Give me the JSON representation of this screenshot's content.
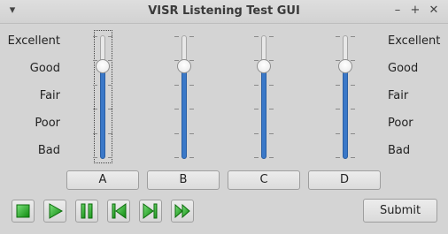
{
  "window": {
    "title": "VISR Listening Test GUI",
    "menu_icon": "chevron-down-icon",
    "minimize_icon": "minimize-icon",
    "maximize_icon": "plus-icon",
    "close_icon": "close-icon"
  },
  "scale_labels": [
    "Excellent",
    "Good",
    "Fair",
    "Poor",
    "Bad"
  ],
  "sliders": [
    {
      "name": "A",
      "value": 0.78
    },
    {
      "name": "B",
      "value": 0.78
    },
    {
      "name": "C",
      "value": 0.78
    },
    {
      "name": "D",
      "value": 0.78
    }
  ],
  "stimulus_buttons": [
    "A",
    "B",
    "C",
    "D"
  ],
  "transport": [
    {
      "name": "stop-icon"
    },
    {
      "name": "play-icon"
    },
    {
      "name": "pause-icon"
    },
    {
      "name": "skip-back-icon"
    },
    {
      "name": "skip-forward-icon"
    },
    {
      "name": "fast-forward-icon"
    }
  ],
  "submit_label": "Submit",
  "colors": {
    "accent": "#3a78c8",
    "transport_green": "#18a818"
  }
}
